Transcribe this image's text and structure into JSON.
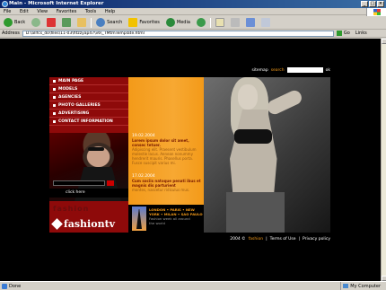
{
  "window": {
    "title": "Main - Microsoft Internet Explorer",
    "controls": [
      "_",
      "□",
      "×"
    ]
  },
  "menubar": [
    "File",
    "Edit",
    "View",
    "Favorites",
    "Tools",
    "Help"
  ],
  "toolbar": {
    "back": "Back",
    "search": "Search",
    "favorites": "Favorites",
    "media": "Media"
  },
  "address": {
    "label": "Address",
    "url": "D:\\allfcs_do\\files\\11-03\\fitzzyap47\\v6\\_TMtmTemplate.html",
    "go": "Go",
    "links": "Links"
  },
  "status": {
    "left": "Done",
    "zone": "My Computer"
  },
  "site": {
    "topnav": {
      "sitemap": "sitemap",
      "search": "search",
      "ok": "ok"
    },
    "menu": [
      "main page",
      "models",
      "agencies",
      "photo galleries",
      "advertising",
      "contact information"
    ],
    "click_here": "click here",
    "faded_text": "fashion",
    "logo_text": "fashiontv",
    "news": [
      {
        "date": "19.02.2004",
        "head": "Lorem ipsum dolor sit amet, consec tetuer.",
        "body": "Adipiscing elit. Praesent vestibulum molestie lacus. Aenean nonummy hendrerit mauris. Phasellus porta. Fusce suscipit varius mi."
      },
      {
        "date": "17.02.2004",
        "head": "Cum sociis natoque penati ibus et magnis dis parturient",
        "body": "montes, nascetur ridiculus mus."
      }
    ],
    "cities": {
      "line1": "LONDON • PARIS • NEW",
      "line2": "YORK • MILAN • SAO PAULO",
      "sub1": "Fashion week all around",
      "sub2": "the world"
    },
    "footer": {
      "copyright": "2004 ©",
      "brand": "fashion",
      "sep": "|",
      "terms": "Terms of Use",
      "privacy": "Privacy policy"
    }
  }
}
